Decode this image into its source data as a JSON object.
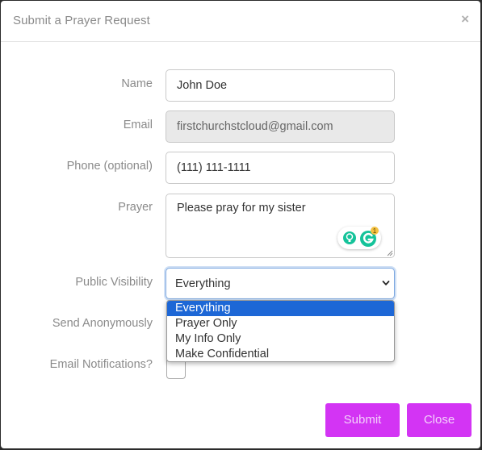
{
  "modal": {
    "title": "Submit a Prayer Request",
    "close_glyph": "×"
  },
  "form": {
    "name_label": "Name",
    "name_value": "John Doe",
    "email_label": "Email",
    "email_value": "firstchurchstcloud@gmail.com",
    "phone_label": "Phone (optional)",
    "phone_value": "(111) 111-1111",
    "prayer_label": "Prayer",
    "prayer_value": "Please pray for my sister",
    "visibility_label": "Public Visibility",
    "visibility_value": "Everything",
    "visibility_options": [
      "Everything",
      "Prayer Only",
      "My Info Only",
      "Make Confidential"
    ],
    "anonymous_label": "Send Anonymously",
    "notifications_label": "Email Notifications?"
  },
  "grammarly": {
    "badge_count": "1",
    "icon": "grammarly-icon",
    "bulb_icon": "lightbulb-icon"
  },
  "footer": {
    "submit_label": "Submit",
    "close_label": "Close"
  },
  "colors": {
    "accent": "#d334f4",
    "option_selected": "#1d67d6",
    "grammarly_green": "#15c39a"
  }
}
